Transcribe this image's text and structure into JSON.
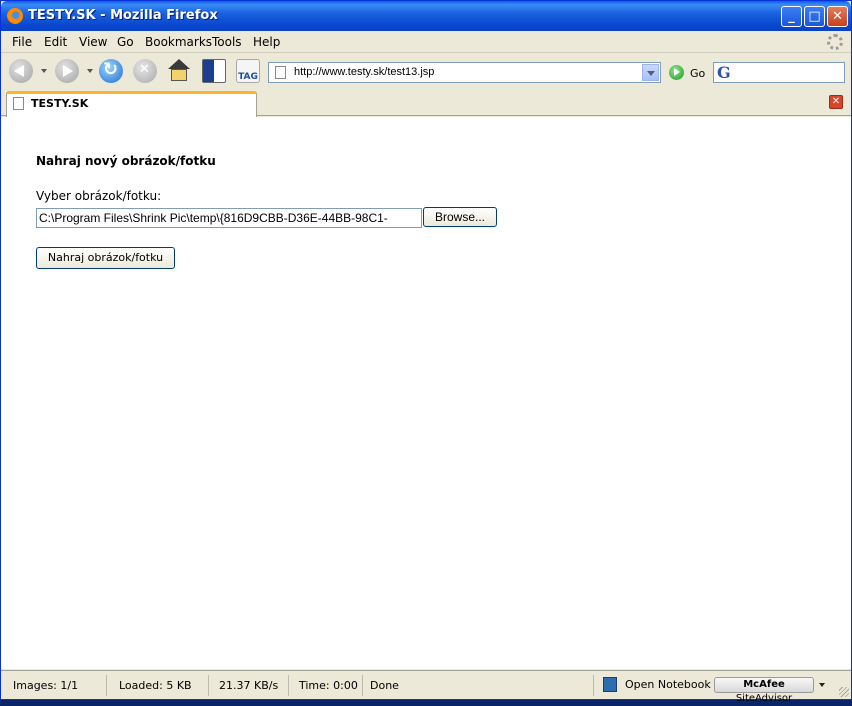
{
  "window": {
    "title": "TESTY.SK - Mozilla Firefox",
    "btn_min": "_",
    "btn_max": "□",
    "btn_close": "✕"
  },
  "menu": {
    "items": [
      "File",
      "Edit",
      "View",
      "Go",
      "Bookmarks",
      "Tools",
      "Help"
    ]
  },
  "nav": {
    "url": "http://www.testy.sk/test13.jsp",
    "go_label": "Go",
    "tag_label": "TAG",
    "search_value": ""
  },
  "tabs": [
    {
      "title": "TESTY.SK"
    }
  ],
  "page": {
    "heading": "Nahraj nový obrázok/fotku",
    "file_label": "Vyber obrázok/fotku:",
    "file_value": "C:\\Program Files\\Shrink Pic\\temp\\{816D9CBB-D36E-44BB-98C1-",
    "browse_label": "Browse...",
    "submit_label": "Nahraj obrázok/fotku"
  },
  "status": {
    "images": "Images: 1/1",
    "loaded": "Loaded: 5 KB",
    "speed": "21.37 KB/s",
    "time": "Time: 0:00",
    "state": "Done",
    "notebook": "Open Notebook",
    "siteadvisor_brand": "McAfee",
    "siteadvisor_name": "SiteAdvisor"
  },
  "colors": {
    "titlebar": "#0a5ce8",
    "chrome": "#ece9d8",
    "tab_accent": "#ffb22b"
  }
}
